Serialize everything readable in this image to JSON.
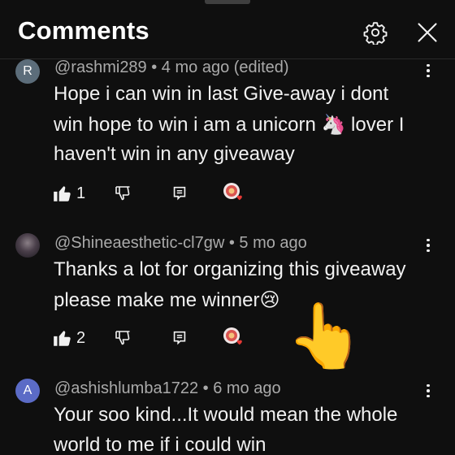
{
  "header": {
    "title": "Comments",
    "settings_icon": "gear-icon",
    "close_icon": "close-icon"
  },
  "comments": [
    {
      "avatar_letter": "R",
      "author": "@rashmi289",
      "meta": "@rashmi289 • 4 mo ago (edited)",
      "lines": [
        "Hope i can win in last Give-away i dont",
        "win hope to win i am a unicorn 🦄 lover  I",
        "haven't win in any giveaway"
      ],
      "likes": "1"
    },
    {
      "avatar_letter": "",
      "author": "@Shineaesthetic-cl7gw",
      "meta": "@Shineaesthetic-cl7gw • 5 mo ago",
      "lines": [
        "Thanks a lot for organizing this giveaway",
        "please make me winner😢"
      ],
      "likes": "2"
    },
    {
      "avatar_letter": "A",
      "author": "@ashishlumba1722",
      "meta": "@ashishlumba1722 • 6 mo ago",
      "lines": [
        "Your soo kind...It would mean the whole",
        "world to me if i could win"
      ]
    }
  ],
  "overlay": {
    "pointer_emoji": "👆"
  },
  "colors": {
    "background": "#0f0f0f",
    "text": "#f1f1f1",
    "meta": "#aaaaaa",
    "heart": "#e53935"
  }
}
